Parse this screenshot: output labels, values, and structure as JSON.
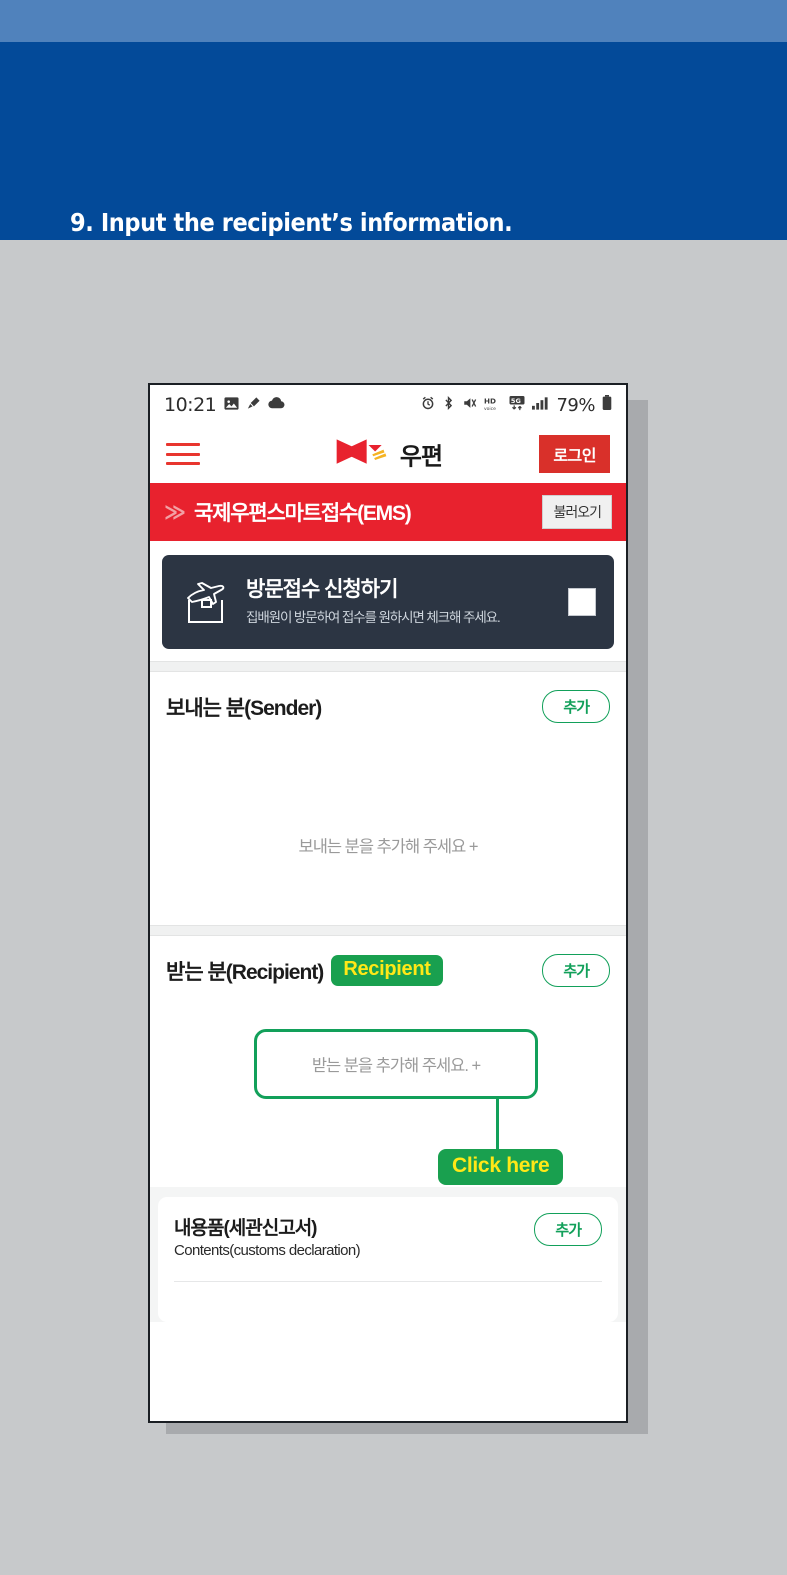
{
  "banner": {
    "title": "9. Input the recipient’s information.",
    "bg_color": "#034a99",
    "strip_color": "#5082bc"
  },
  "phone": {
    "statusbar": {
      "time": "10:21",
      "left_icons": [
        "image-icon",
        "paint-icon",
        "cloud-icon"
      ],
      "right_icons": [
        "alarm-icon",
        "bluetooth-icon",
        "mute-icon",
        "hd-voice-icon",
        "5g-icon",
        "signal-bars-icon"
      ],
      "battery_percent": "79%"
    },
    "appbar": {
      "menu_icon": "hamburger-icon",
      "brand_logo": "korea-post-logo",
      "brand_text": "우편",
      "login_label": "로그인"
    },
    "subbar": {
      "chevron": "≫",
      "title": "국제우편스마트접수(EMS)",
      "load_label": "불러오기",
      "bg_color": "#e8222e"
    },
    "visit_card": {
      "icon": "airplane-box-icon",
      "title": "방문접수 신청하기",
      "subtitle": "집배원이 방문하여 접수를 원하시면 체크해 주세요.",
      "checked": false,
      "bg_color": "#2c3543"
    },
    "sender_section": {
      "title": "보내는 분(Sender)",
      "add_label": "추가",
      "empty_hint": "보내는 분을 추가해 주세요 +"
    },
    "recipient_section": {
      "title": "받는 분(Recipient)",
      "badge_label": "Recipient",
      "add_label": "추가",
      "empty_hint": "받는 분을 추가해 주세요. +",
      "callout_label": "Click here",
      "highlight_color": "#12a05a",
      "badge_text_color": "#ffe817"
    },
    "contents_section": {
      "title": "내용품(세관신고서)",
      "subtitle": "Contents(customs declaration)",
      "add_label": "추가"
    }
  }
}
